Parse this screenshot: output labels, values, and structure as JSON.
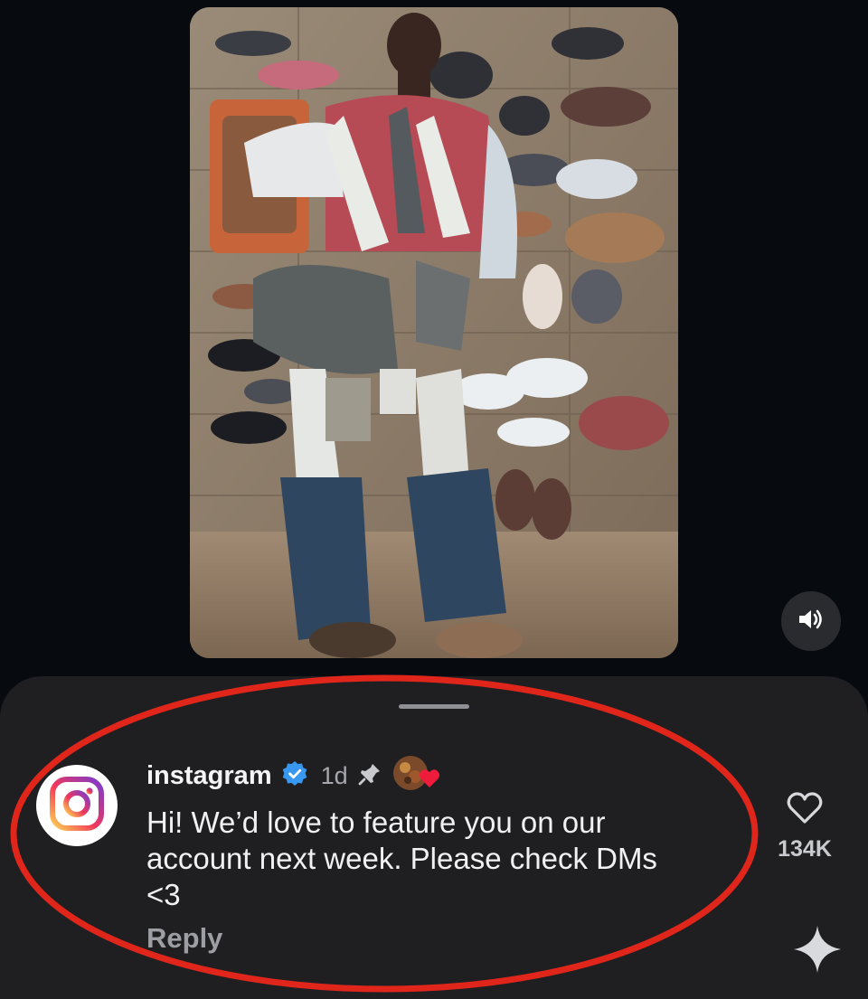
{
  "media": {
    "image_description_icon": "photo-of-person-wearing-shoes-on-wall",
    "sound_icon": "speaker-icon"
  },
  "comment": {
    "username": "instagram",
    "verified_icon": "verified-badge-icon",
    "time": "1d",
    "pinned_icon": "pin-icon",
    "liked_by_creator_icon": "creator-heart-icon",
    "text": "Hi! We’d love to feature you on our\naccount next week. Please check DMs\n<3",
    "reply_label": "Reply",
    "like_count": "134K",
    "like_icon": "heart-outline-icon"
  },
  "colors": {
    "background": "#070a0f",
    "sheet": "#1f1f22",
    "verified": "#3897f0",
    "annotation_ring": "#e0261b"
  }
}
